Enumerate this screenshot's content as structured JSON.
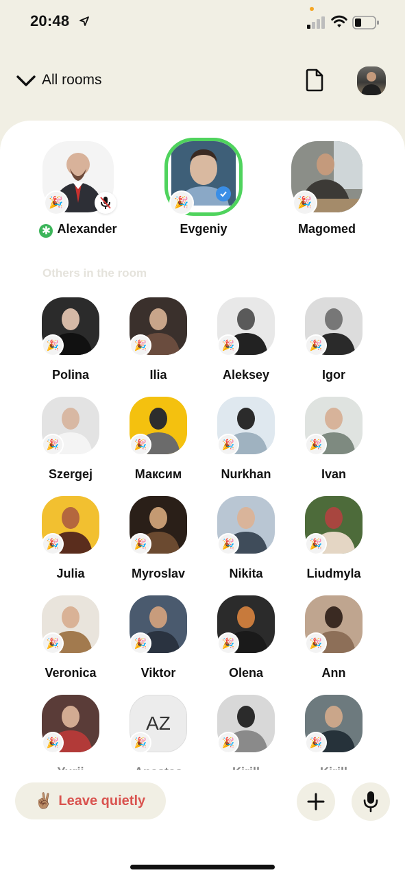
{
  "status_bar": {
    "time": "20:48"
  },
  "header": {
    "title": "All rooms"
  },
  "speakers": [
    {
      "name": "Alexander",
      "muted": true,
      "moderator_icon": "green-asterisk-icon",
      "photo": [
        "#f4f4f4",
        "#c9c9c9",
        "#2d2f36"
      ]
    },
    {
      "name": "Evgeniy",
      "speaking": true,
      "verified": true,
      "photo": [
        "#3e5f78",
        "#d9b9a0",
        "#8aa8c6"
      ]
    },
    {
      "name": "Magomed",
      "photo": [
        "#8b8e88",
        "#3c3a36",
        "#a48b6a"
      ]
    }
  ],
  "section_label": "Others in the room",
  "listeners": [
    {
      "name": "Polina",
      "photo": [
        "#2b2b2b",
        "#d5b9a6",
        "#111111"
      ]
    },
    {
      "name": "Ilia",
      "photo": [
        "#3a302c",
        "#c8a58a",
        "#6a4c3e"
      ]
    },
    {
      "name": "Aleksey",
      "photo": [
        "#e8e8e8",
        "#5a5a5a",
        "#222222"
      ]
    },
    {
      "name": "Igor",
      "photo": [
        "#dcdcdc",
        "#777777",
        "#2a2a2a"
      ]
    },
    {
      "name": "Szergej",
      "photo": [
        "#e3e3e3",
        "#d8b8a3",
        "#f4f4f4"
      ]
    },
    {
      "name": "Максим",
      "photo": [
        "#f4c10f",
        "#2d2d2d",
        "#6b6b6b"
      ]
    },
    {
      "name": "Nurkhan",
      "photo": [
        "#dfe8ef",
        "#2b2b2b",
        "#9fb2c0"
      ]
    },
    {
      "name": "Ivan",
      "photo": [
        "#dfe3e0",
        "#d7b39a",
        "#7e8a80"
      ]
    },
    {
      "name": "Julia",
      "photo": [
        "#f2c030",
        "#b4673e",
        "#5a2d1d"
      ]
    },
    {
      "name": "Myroslav",
      "photo": [
        "#2a1f18",
        "#c49a72",
        "#6b4a30"
      ]
    },
    {
      "name": "Nikita",
      "photo": [
        "#b9c6d3",
        "#d9b49a",
        "#3f4c5a"
      ]
    },
    {
      "name": "Liudmyla",
      "photo": [
        "#4d6b3a",
        "#a8463f",
        "#e4d6c4"
      ]
    },
    {
      "name": "Veronica",
      "photo": [
        "#e9e4dc",
        "#d9b296",
        "#a27a4e"
      ]
    },
    {
      "name": "Viktor",
      "photo": [
        "#4a5a6e",
        "#c89c7c",
        "#2a3340"
      ]
    },
    {
      "name": "Olena",
      "photo": [
        "#2b2b2b",
        "#c77a3c",
        "#1a1a1a"
      ]
    },
    {
      "name": "Ann",
      "photo": [
        "#bfa58f",
        "#3a2a22",
        "#8d6f58"
      ]
    },
    {
      "name": "Yurii",
      "photo": [
        "#5a3c38",
        "#d2ab92",
        "#b23a38"
      ]
    },
    {
      "name": "Anastas",
      "initials": "AZ"
    },
    {
      "name": "Kirill",
      "photo": [
        "#d8d8d8",
        "#2b2b2b",
        "#8a8a8a"
      ]
    },
    {
      "name": "Kirill",
      "photo": [
        "#6d7a7e",
        "#caa68a",
        "#26323a"
      ]
    }
  ],
  "badge_emoji": "🎉",
  "footer": {
    "leave_label": "Leave quietly",
    "leave_emoji": "✌🏽"
  },
  "colors": {
    "active_ring": "#4fd35d",
    "leave_text": "#d9534f",
    "background": "#f1efe4"
  }
}
